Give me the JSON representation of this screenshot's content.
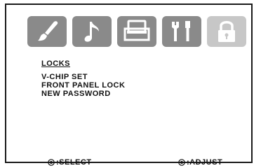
{
  "menu": {
    "tabs": [
      {
        "icon": "paintbrush-icon",
        "active": false
      },
      {
        "icon": "music-note-icon",
        "active": false
      },
      {
        "icon": "tv-monitor-icon",
        "active": false
      },
      {
        "icon": "tools-icon",
        "active": false
      },
      {
        "icon": "padlock-icon",
        "active": true
      }
    ],
    "heading": "LOCKS",
    "items": [
      {
        "label": "V-CHIP SET"
      },
      {
        "label": "FRONT PANEL LOCK"
      },
      {
        "label": "NEW PASSWORD"
      }
    ]
  },
  "footer": {
    "select_label": ":SELECT",
    "adjust_label": ":ADJUST"
  },
  "colors": {
    "tile": "#8a8a8a",
    "tile_active": "#c7c7c7",
    "text": "#111111"
  }
}
